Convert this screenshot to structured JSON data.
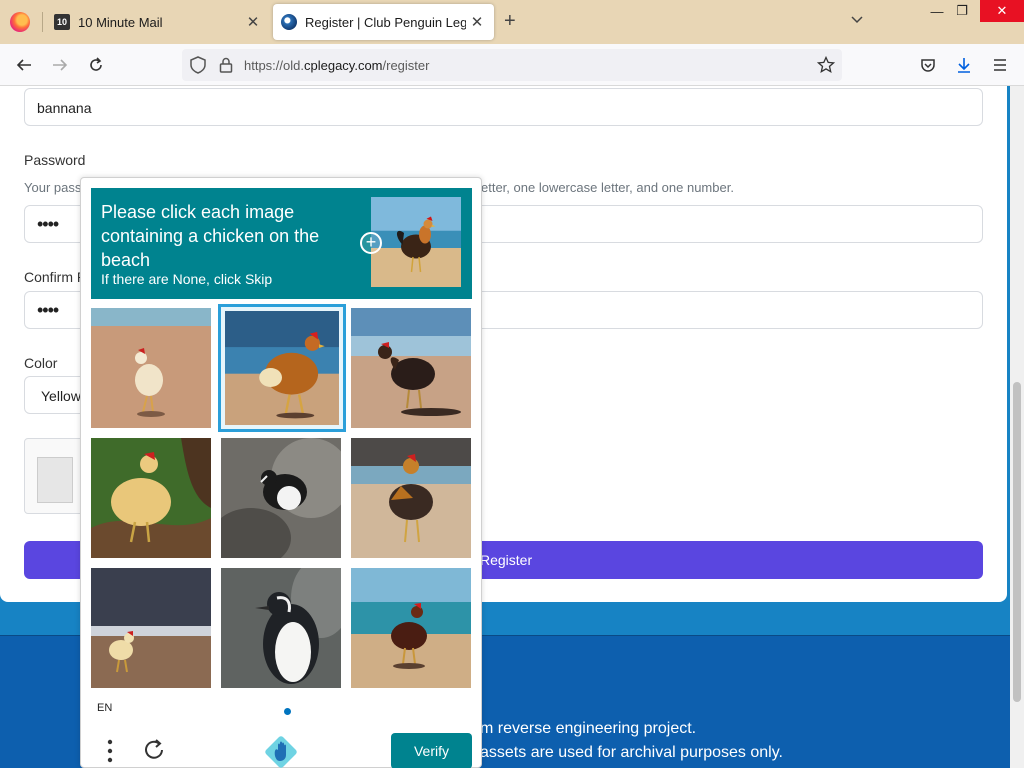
{
  "browser": {
    "tabs": [
      {
        "title": "10 Minute Mail",
        "favicon": "10"
      },
      {
        "title": "Register | Club Penguin Legacy"
      }
    ],
    "url_prefix": "https://old.",
    "url_host": "cplegacy.com",
    "url_path": "/register"
  },
  "form": {
    "username_value": "bannana",
    "password_label": "Password",
    "password_hint_left": "Your pass",
    "password_hint_right": "etter, one lowercase letter, and one number.",
    "password_value": "••••",
    "confirm_label": "Confirm P",
    "confirm_value": "••••",
    "color_label": "Color",
    "color_value": "Yellow",
    "register_label": "Register"
  },
  "footer": {
    "line1": "m reverse engineering project.",
    "line2": "assets are used for archival purposes only."
  },
  "captcha": {
    "prompt": "Please click each image containing a chicken on the beach",
    "sub": "If there are None, click Skip",
    "tiles": [
      "chicken-on-beach",
      "chicken-on-beach",
      "chicken-on-beach",
      "chicken-on-branch",
      "penguin",
      "chicken-on-beach",
      "chicken-on-beach",
      "penguin",
      "chicken-on-beach"
    ],
    "selected_tile_index": 1,
    "language": "EN",
    "verify_label": "Verify"
  },
  "colors": {
    "accent_teal": "#00838f",
    "register_purple": "#5a46e0",
    "page_blue": "#1783c4"
  }
}
